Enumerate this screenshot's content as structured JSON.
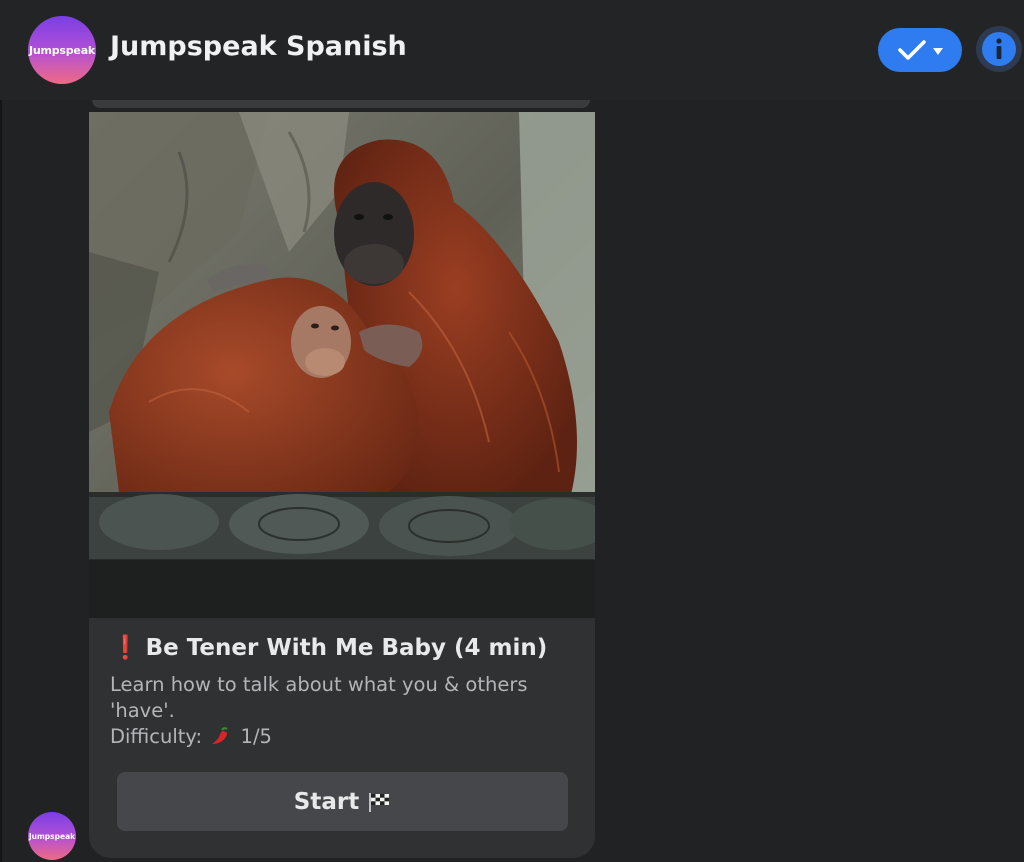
{
  "header": {
    "avatar_text": "Jumpspeak",
    "title": "Jumpspeak Spanish"
  },
  "card": {
    "image_subject": "two orangutans hugging on a wooden log",
    "title_icon": "red-exclamation-icon",
    "title": "Be Tener With Me Baby (4 min)",
    "description": "Learn how to talk about what you & others 'have'.",
    "difficulty_label": "Difficulty:",
    "difficulty_icon": "chili-pepper-icon",
    "difficulty_value": "1/5",
    "start_label": "Start",
    "start_icon": "checkered-flag-icon"
  },
  "footer": {
    "avatar_text": "Jumpspeak"
  },
  "colors": {
    "background": "#212224",
    "card": "#303133",
    "button": "#46474a",
    "accent_blue": "#2e7cf0",
    "avatar_gradient_top": "#7b3fe4",
    "avatar_gradient_bottom": "#ef6a86"
  }
}
